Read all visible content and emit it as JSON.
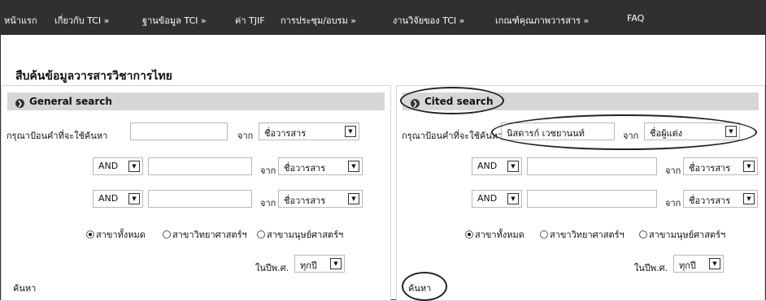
{
  "nav": [
    {
      "label": "หน้าแรก"
    },
    {
      "label": "เกี่ยวกับ TCI  »"
    },
    {
      "label": "ฐานข้อมูล TCI  »"
    },
    {
      "label": "ค่า TJIF"
    },
    {
      "label": "การประชุม/อบรม  »"
    },
    {
      "label": "งานวิจัยของ TCI  »"
    },
    {
      "label": "เกณฑ์คุณภาพวารสาร  »"
    },
    {
      "label": "FAQ"
    }
  ],
  "page_title": "สืบค้นข้อมูลวารสารวิชาการไทย",
  "general": {
    "heading": "General search",
    "prompt": "กรุณาป้อนคำที่จะใช้ค้นหา",
    "row1": {
      "value": "",
      "from": "จาก",
      "field": "ชื่อวารสาร"
    },
    "row2": {
      "op": "AND",
      "value": "",
      "from": "จาก",
      "field": "ชื่อวารสาร"
    },
    "row3": {
      "op": "AND",
      "value": "",
      "from": "จาก",
      "field": "ชื่อวารสาร"
    },
    "radios": [
      "สาขาทั้งหมด",
      "สาขาวิทยาศาสตร์ฯ",
      "สาขามนุษย์ศาสตร์ฯ"
    ],
    "year_label": "ในปีพ.ศ.",
    "year_value": "ทุกปี",
    "search_button": "ค้นหา"
  },
  "cited": {
    "heading": "Cited search",
    "prompt": "กรุณาป้อนคำที่จะใช้ค้นหา",
    "row1": {
      "value": "นิสดารก์ เวชยานนท์",
      "from": "จาก",
      "field": "ชื่อผู้แต่ง"
    },
    "row2": {
      "op": "AND",
      "value": "",
      "from": "จาก",
      "field": "ชื่อวารสาร"
    },
    "row3": {
      "op": "AND",
      "value": "",
      "from": "จาก",
      "field": "ชื่อวารสาร"
    },
    "radios": [
      "สาขาทั้งหมด",
      "สาขาวิทยาศาสตร์ฯ",
      "สาขามนุษย์ศาสตร์ฯ"
    ],
    "year_label": "ในปีพ.ศ.",
    "year_value": "ทุกปี",
    "search_button": "ค้นหา"
  },
  "icons": {
    "collapse": "circle-chevron-icon",
    "dropdown": "dropdown-arrow-icon",
    "radio_selected": "radio-selected-icon"
  },
  "colors": {
    "nav_bg": "#303030",
    "panel_bar": "#d6d6d6",
    "annotation": "#222222"
  }
}
